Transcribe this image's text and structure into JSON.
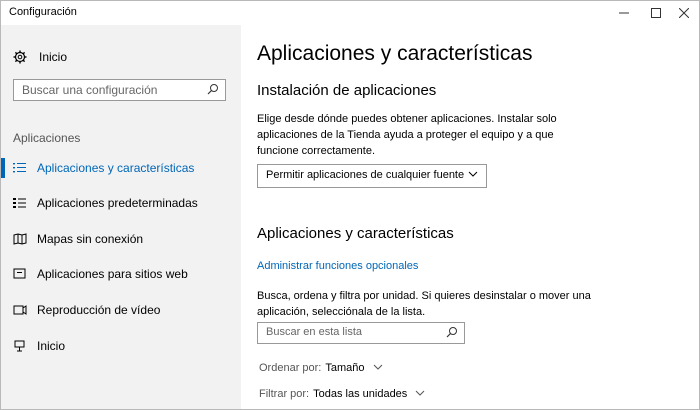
{
  "window": {
    "title": "Configuración",
    "controls": [
      "minimize",
      "maximize",
      "close"
    ]
  },
  "sidebar": {
    "home_label": "Inicio",
    "search_placeholder": "Buscar una configuración",
    "section_label": "Aplicaciones",
    "items": [
      {
        "label": "Aplicaciones y características",
        "icon": "list-icon",
        "active": true
      },
      {
        "label": "Aplicaciones predeterminadas",
        "icon": "list-default-icon",
        "active": false
      },
      {
        "label": "Mapas sin conexión",
        "icon": "map-icon",
        "active": false
      },
      {
        "label": "Aplicaciones para sitios web",
        "icon": "website-app-icon",
        "active": false
      },
      {
        "label": "Reproducción de vídeo",
        "icon": "video-icon",
        "active": false
      },
      {
        "label": "Inicio",
        "icon": "startup-icon",
        "active": false
      }
    ]
  },
  "main": {
    "title": "Aplicaciones y características",
    "install_heading": "Instalación de aplicaciones",
    "install_text": "Elige desde dónde puedes obtener aplicaciones. Instalar solo aplicaciones de la Tienda ayuda a proteger el equipo y a que funcione correctamente.",
    "install_dropdown_value": "Permitir aplicaciones de cualquier fuente",
    "apps_heading": "Aplicaciones y características",
    "optional_link": "Administrar funciones opcionales",
    "apps_text": "Busca, ordena y filtra por unidad. Si quieres desinstalar o mover una aplicación, selecciónala de la lista.",
    "list_search_placeholder": "Buscar en esta lista",
    "sort_label": "Ordenar por:",
    "sort_value": "Tamaño",
    "filter_label": "Filtrar por:",
    "filter_value": "Todas las unidades"
  },
  "colors": {
    "accent": "#0067b8",
    "sidebar_bg": "#f2f2f2"
  }
}
